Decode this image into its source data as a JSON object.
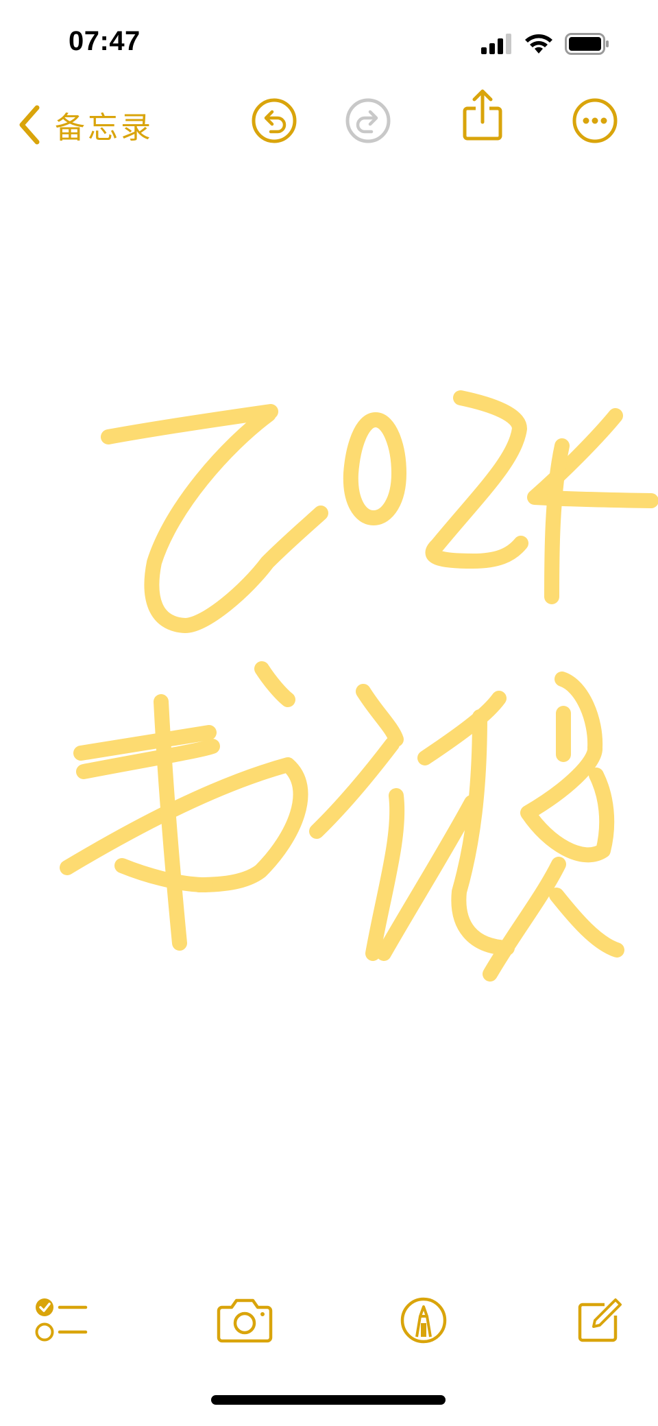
{
  "status": {
    "time": "07:47"
  },
  "nav": {
    "back_label": "备忘录"
  },
  "colors": {
    "accent": "#d9a40b",
    "ink": "#fdd865",
    "disabled": "#c8c8c8"
  },
  "icons": {
    "back": "chevron-left-icon",
    "undo": "undo-icon",
    "redo": "redo-icon",
    "share": "share-icon",
    "more": "ellipsis-circle-icon",
    "checklist": "checklist-icon",
    "camera": "camera-icon",
    "markup": "markup-pen-icon",
    "compose": "compose-icon"
  }
}
